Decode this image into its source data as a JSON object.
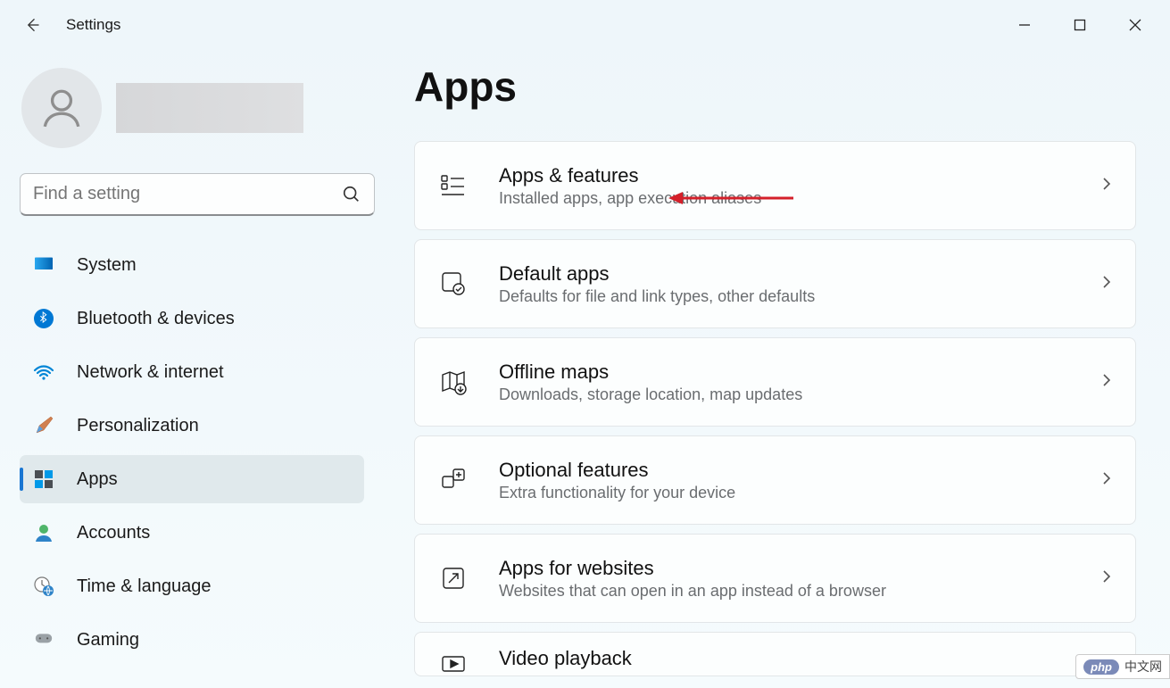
{
  "window": {
    "title": "Settings"
  },
  "sidebar": {
    "search_placeholder": "Find a setting",
    "items": [
      {
        "label": "System",
        "icon": "display-icon",
        "selected": false
      },
      {
        "label": "Bluetooth & devices",
        "icon": "bluetooth-icon",
        "selected": false
      },
      {
        "label": "Network & internet",
        "icon": "wifi-icon",
        "selected": false
      },
      {
        "label": "Personalization",
        "icon": "brush-icon",
        "selected": false
      },
      {
        "label": "Apps",
        "icon": "apps-icon",
        "selected": true
      },
      {
        "label": "Accounts",
        "icon": "person-icon",
        "selected": false
      },
      {
        "label": "Time & language",
        "icon": "clock-globe-icon",
        "selected": false
      },
      {
        "label": "Gaming",
        "icon": "gamepad-icon",
        "selected": false
      }
    ]
  },
  "page": {
    "title": "Apps",
    "cards": [
      {
        "title": "Apps & features",
        "desc": "Installed apps, app execution aliases",
        "icon": "apps-list-icon",
        "highlighted": true
      },
      {
        "title": "Default apps",
        "desc": "Defaults for file and link types, other defaults",
        "icon": "default-apps-icon"
      },
      {
        "title": "Offline maps",
        "desc": "Downloads, storage location, map updates",
        "icon": "map-icon"
      },
      {
        "title": "Optional features",
        "desc": "Extra functionality for your device",
        "icon": "optional-features-icon"
      },
      {
        "title": "Apps for websites",
        "desc": "Websites that can open in an app instead of a browser",
        "icon": "apps-websites-icon"
      },
      {
        "title": "Video playback",
        "desc": "",
        "icon": "video-icon"
      }
    ]
  },
  "watermark": {
    "badge": "php",
    "text": "中文网"
  }
}
